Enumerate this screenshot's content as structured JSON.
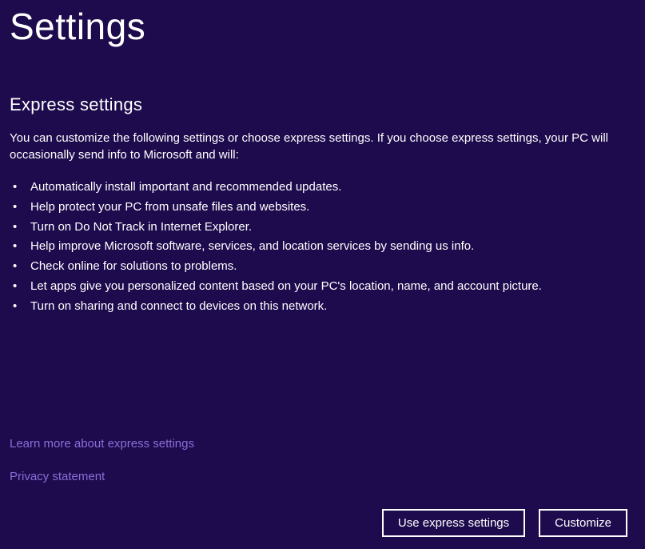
{
  "page_title": "Settings",
  "section_title": "Express settings",
  "description": "You can customize the following settings or choose express settings. If you choose express settings, your PC will occasionally send info to Microsoft and will:",
  "bullets": [
    "Automatically install important and recommended updates.",
    "Help protect your PC from unsafe files and websites.",
    "Turn on Do Not Track in Internet Explorer.",
    "Help improve Microsoft software, services, and location services by sending us info.",
    "Check online for solutions to problems.",
    "Let apps give you personalized content based on your PC's location, name, and account picture.",
    "Turn on sharing and connect to devices on this network."
  ],
  "links": {
    "learn_more": "Learn more about express settings",
    "privacy": "Privacy statement"
  },
  "buttons": {
    "express": "Use express settings",
    "customize": "Customize"
  }
}
